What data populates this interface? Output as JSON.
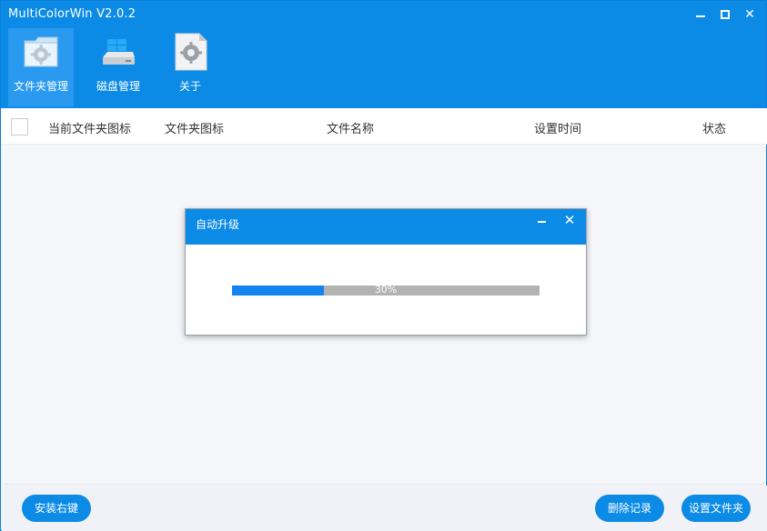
{
  "app": {
    "title": "MultiColorWin V2.0.2"
  },
  "window_controls": {
    "minimize": "minimize-icon",
    "maximize": "maximize-icon",
    "close": "close-icon"
  },
  "nav": {
    "items": [
      {
        "label": "文件夹管理",
        "icon": "folder-gear-icon",
        "active": true
      },
      {
        "label": "磁盘管理",
        "icon": "disk-drive-icon",
        "active": false
      },
      {
        "label": "关于",
        "icon": "about-gear-icon",
        "active": false
      }
    ]
  },
  "table": {
    "columns": [
      "当前文件夹图标",
      "文件夹图标",
      "文件名称",
      "设置时间",
      "状态"
    ],
    "rows": []
  },
  "footer": {
    "install_label": "安装右键",
    "delete_label": "删除记录",
    "set_folder_label": "设置文件夹"
  },
  "dialog": {
    "title": "自动升级",
    "progress_percent": 30,
    "progress_text": "30%"
  },
  "colors": {
    "accent": "#0b8be6",
    "progress_fill": "#1384ef",
    "progress_track": "#b3b3b3"
  }
}
